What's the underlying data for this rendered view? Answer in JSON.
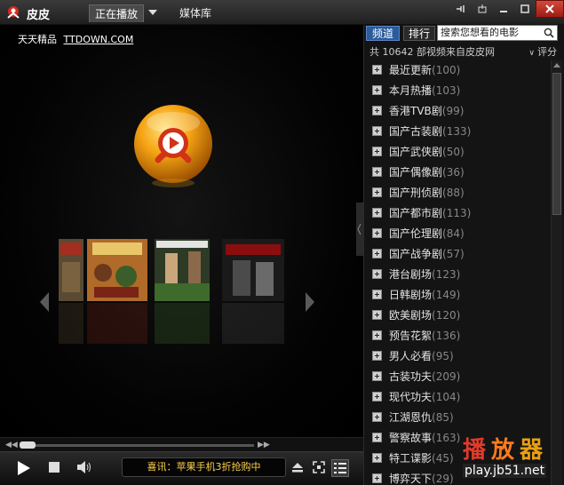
{
  "app": {
    "title": "皮皮"
  },
  "nav": {
    "now_playing": "正在播放",
    "media_library": "媒体库"
  },
  "window_buttons": [
    "mini-mode-icon",
    "pin-icon",
    "minimize-icon",
    "maximize-icon",
    "close-icon"
  ],
  "video": {
    "brand_text": "天天精品",
    "brand_url": "TTDOWN.COM"
  },
  "panel": {
    "tabs": [
      {
        "label": "频道"
      },
      {
        "label": "排行"
      }
    ],
    "search_placeholder": "搜索您想看的电影",
    "stats": "共 10642 部视频来自皮皮网",
    "sort_label": "评分",
    "categories": [
      {
        "name": "最近更新",
        "count": "(100)"
      },
      {
        "name": "本月热播",
        "count": "(103)"
      },
      {
        "name": "香港TVB剧",
        "count": "(99)"
      },
      {
        "name": "国产古装剧",
        "count": "(133)"
      },
      {
        "name": "国产武侠剧",
        "count": "(50)"
      },
      {
        "name": "国产偶像剧",
        "count": "(36)"
      },
      {
        "name": "国产刑侦剧",
        "count": "(88)"
      },
      {
        "name": "国产都市剧",
        "count": "(113)"
      },
      {
        "name": "国产伦理剧",
        "count": "(84)"
      },
      {
        "name": "国产战争剧",
        "count": "(57)"
      },
      {
        "name": "港台剧场",
        "count": "(123)"
      },
      {
        "name": "日韩剧场",
        "count": "(149)"
      },
      {
        "name": "欧美剧场",
        "count": "(120)"
      },
      {
        "name": "预告花絮",
        "count": "(136)"
      },
      {
        "name": "男人必看",
        "count": "(95)"
      },
      {
        "name": "古装功夫",
        "count": "(209)"
      },
      {
        "name": "现代功夫",
        "count": "(104)"
      },
      {
        "name": "江湖恩仇",
        "count": "(85)"
      },
      {
        "name": "警察故事",
        "count": "(163)"
      },
      {
        "name": "特工谍影",
        "count": "(45)"
      },
      {
        "name": "博弈天下",
        "count": "(29)"
      }
    ]
  },
  "controls": {
    "ticker": "喜讯：苹果手机3折抢购中"
  },
  "watermark": {
    "hanzi": "播放器",
    "url": "play.jb51.net"
  },
  "colors": {
    "accent_tab": "#2c5a9a",
    "ticker_text": "#ffd24d",
    "close_button": "#c0392b"
  }
}
